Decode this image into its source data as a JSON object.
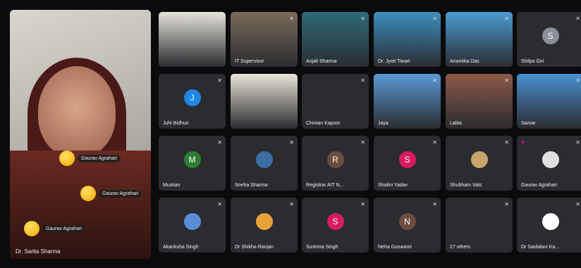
{
  "main": {
    "name": "Dr. Sarita Sharma",
    "reactions": [
      "Gaurav Agrahari",
      "Gaurav Agrahari",
      "Gaurav Agrahari"
    ]
  },
  "tiles": [
    {
      "name": "",
      "avatar": "",
      "color": "",
      "video": true,
      "bg": "#e6e3dc"
    },
    {
      "name": "IT Supervisor",
      "avatar": "",
      "color": "",
      "video": true,
      "bg": "#7a6b5a"
    },
    {
      "name": "Anjali Sharma",
      "avatar": "",
      "color": "",
      "video": true,
      "bg": "#2e6b7a"
    },
    {
      "name": "Dr. Jyoti Tiwari",
      "avatar": "",
      "color": "",
      "video": true,
      "bg": "#3d8fbd"
    },
    {
      "name": "Anamika Das",
      "avatar": "",
      "color": "",
      "video": true,
      "bg": "#4b9cd3"
    },
    {
      "name": "Shilpa Giri",
      "avatar": "S",
      "color": "#8a8f98",
      "video": false,
      "bg": ""
    },
    {
      "name": "Juhi Bidhuri",
      "avatar": "J",
      "color": "#1e88e5",
      "video": false,
      "bg": ""
    },
    {
      "name": "",
      "avatar": "",
      "color": "",
      "video": true,
      "bg": "#e9e4d8"
    },
    {
      "name": "Chintan Kapoor",
      "avatar": "",
      "color": "",
      "video": false,
      "bg": ""
    },
    {
      "name": "Jaya",
      "avatar": "",
      "color": "",
      "video": true,
      "bg": "#5a9ad6"
    },
    {
      "name": "Lalita",
      "avatar": "",
      "color": "",
      "video": true,
      "bg": "#8c5a4a"
    },
    {
      "name": "Samar",
      "avatar": "",
      "color": "",
      "video": true,
      "bg": "#4a8fd0"
    },
    {
      "name": "Muskan",
      "avatar": "M",
      "color": "#2e7d32",
      "video": false,
      "bg": ""
    },
    {
      "name": "Sneha Sharma",
      "avatar": "",
      "color": "#3a6ea5",
      "video": false,
      "bg": ""
    },
    {
      "name": "Registrar AIT N...",
      "avatar": "R",
      "color": "#6d4c41",
      "video": false,
      "bg": ""
    },
    {
      "name": "Shalini Yadav",
      "avatar": "S",
      "color": "#d81b60",
      "video": false,
      "bg": ""
    },
    {
      "name": "Shubham Vats",
      "avatar": "",
      "color": "#c8a46a",
      "video": false,
      "bg": ""
    },
    {
      "name": "Gaurav Agrahari",
      "avatar": "",
      "color": "#e0e0e0",
      "video": false,
      "bg": ""
    },
    {
      "name": "Akanksha Singh",
      "avatar": "",
      "color": "#5b8ed8",
      "video": false,
      "bg": ""
    },
    {
      "name": "Dr Shikha Ranjan",
      "avatar": "",
      "color": "#e8a23a",
      "video": false,
      "bg": ""
    },
    {
      "name": "Sushma Singh",
      "avatar": "S",
      "color": "#d81b60",
      "video": false,
      "bg": ""
    },
    {
      "name": "Neha Goswami",
      "avatar": "N",
      "color": "#6d4c41",
      "video": false,
      "bg": ""
    },
    {
      "name": "27 others",
      "avatar": "",
      "color": "",
      "video": false,
      "bg": ""
    },
    {
      "name": "Dr Saidalavi Ka...",
      "avatar": "",
      "color": "#ffffff",
      "video": false,
      "bg": ""
    }
  ]
}
